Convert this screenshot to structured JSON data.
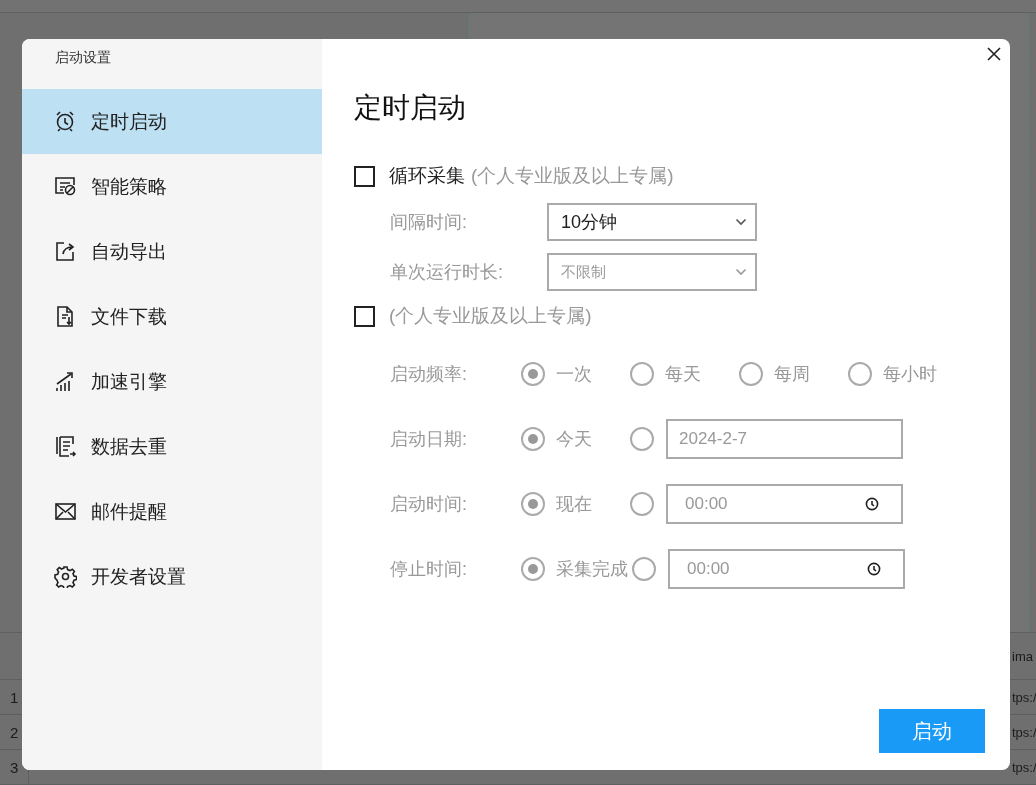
{
  "background": {
    "table": {
      "header_cell": "ima",
      "rows": [
        {
          "number": "1",
          "link": "tps:/"
        },
        {
          "number": "2",
          "link": "tps:/"
        },
        {
          "number": "3",
          "link": "tps:/"
        }
      ]
    }
  },
  "dialog": {
    "sidebar_title": "启动设置",
    "sidebar_items": [
      {
        "label": "定时启动",
        "selected": true
      },
      {
        "label": "智能策略",
        "selected": false
      },
      {
        "label": "自动导出",
        "selected": false
      },
      {
        "label": "文件下载",
        "selected": false
      },
      {
        "label": "加速引擎",
        "selected": false
      },
      {
        "label": "数据去重",
        "selected": false
      },
      {
        "label": "邮件提醒",
        "selected": false
      },
      {
        "label": "开发者设置",
        "selected": false
      }
    ],
    "title": "定时启动",
    "loop": {
      "checked": false,
      "label": "循环采集",
      "note": "(个人专业版及以上专属)",
      "fields": [
        {
          "label": "间隔时间:",
          "value": "10分钟",
          "disabled": false
        },
        {
          "label": "单次运行时长:",
          "value": "不限制",
          "disabled": true
        }
      ]
    },
    "schedule": {
      "checked": false,
      "disabled": true,
      "note": "(个人专业版及以上专属)",
      "rows": [
        {
          "label": "启动频率:",
          "options": [
            {
              "label": "一次",
              "selected": true
            },
            {
              "label": "每天",
              "selected": false
            },
            {
              "label": "每周",
              "selected": false
            },
            {
              "label": "每小时",
              "selected": false
            }
          ]
        },
        {
          "label": "启动日期:",
          "options": [
            {
              "label": "今天",
              "selected": true
            },
            {
              "selected": false,
              "input": {
                "kind": "date",
                "value": "2024-2-7"
              }
            }
          ]
        },
        {
          "label": "启动时间:",
          "options": [
            {
              "label": "现在",
              "selected": true
            },
            {
              "selected": false,
              "input": {
                "kind": "time",
                "value": "00:00"
              }
            }
          ]
        },
        {
          "label": "停止时间:",
          "options": [
            {
              "label": "采集完成",
              "selected": true
            },
            {
              "selected": false,
              "input": {
                "kind": "time",
                "value": "00:00"
              }
            }
          ]
        }
      ]
    },
    "start_button": "启动"
  }
}
